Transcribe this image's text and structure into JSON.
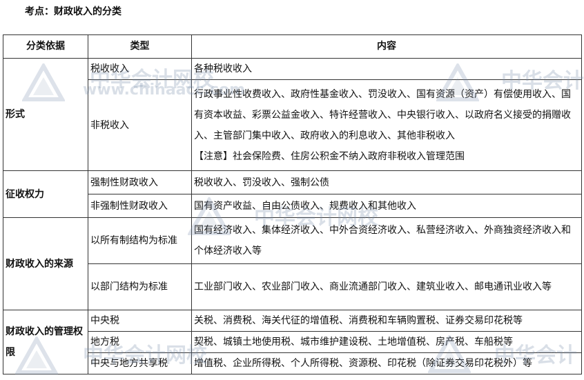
{
  "topic": "考点：财政收入的分类",
  "headers": {
    "basis": "分类依据",
    "type": "类型",
    "content": "内容"
  },
  "groups": {
    "form": {
      "basis": "形式",
      "rows": [
        {
          "type": "税收收入",
          "content": "各种税收收入"
        },
        {
          "type": "非税收入",
          "content": "行政事业性收费收入、政府性基金收入、罚没收入、国有资源（资产）有偿使用收入、国有资本收益、彩票公益金收入、特许经营收入、中央银行收入、以政府名义接受的捐赠收入、主管部门集中收入、政府收入的利息收入、其他非税收入",
          "note": "【注意】社会保险费、住房公积金不纳入政府非税收入管理范围"
        }
      ]
    },
    "power": {
      "basis": "征收权力",
      "rows": [
        {
          "type": "强制性财政收入",
          "content": "税收收入、罚没收入、强制公债"
        },
        {
          "type": "非强制性财政收入",
          "content": "国有资产收益、自由公债收入、规费收入和其他收入"
        }
      ]
    },
    "source": {
      "basis": "财政收入的来源",
      "rows": [
        {
          "type": "以所有制结构为标准",
          "content": "国有经济收入、集体经济收入、中外合资经济收入、私营经济收入、外商独资经济收入和个体经济收入等"
        },
        {
          "type": "以部门结构为标准",
          "content": "工业部门收入、农业部门收入、商业流通部门收入、建筑业收入、邮电通讯业收入等"
        }
      ]
    },
    "authority": {
      "basis": "财政收入的管理权限",
      "rows": [
        {
          "type": "中央税",
          "content": "关税、消费税、海关代征的增值税、消费税和车辆购置税、证券交易印花税等"
        },
        {
          "type": "地方税",
          "content": "契税、城镇土地使用税、城市维护建设税、土地增值税、房产税、车船税等"
        },
        {
          "type": "中央与地方共享税",
          "content": "增值税、企业所得税、个人所得税、资源税、印花税（除证券交易印花税外）等"
        }
      ]
    }
  },
  "watermark": {
    "cn": "中华会计网校",
    "url": "www.chinaacc.com",
    "cn_short": "中华会计"
  }
}
